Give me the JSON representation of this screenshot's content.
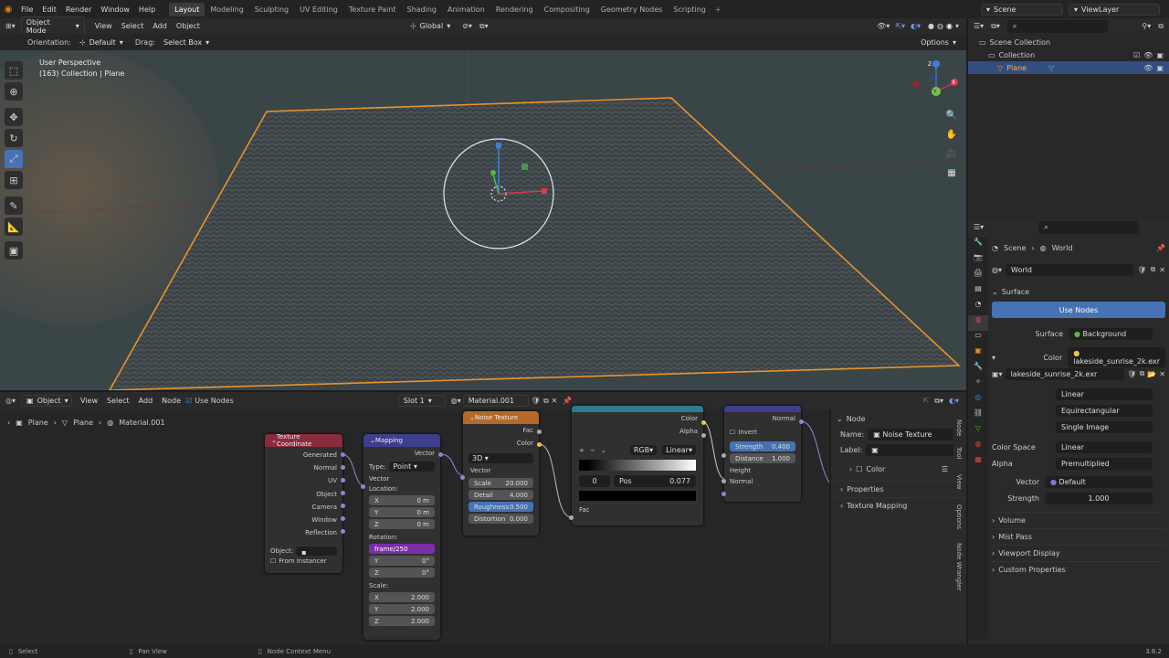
{
  "menubar": {
    "items": [
      "File",
      "Edit",
      "Render",
      "Window",
      "Help"
    ],
    "workspaces": [
      "Layout",
      "Modeling",
      "Sculpting",
      "UV Editing",
      "Texture Paint",
      "Shading",
      "Animation",
      "Rendering",
      "Compositing",
      "Geometry Nodes",
      "Scripting"
    ],
    "active_workspace": "Layout",
    "scene": "Scene",
    "view_layer": "ViewLayer"
  },
  "viewport_header": {
    "mode": "Object Mode",
    "menus": [
      "View",
      "Select",
      "Add",
      "Object"
    ],
    "transform": "Global",
    "options": "Options"
  },
  "tool_settings": {
    "orientation_label": "Orientation:",
    "orientation": "Default",
    "drag_label": "Drag:",
    "drag": "Select Box"
  },
  "viewport": {
    "perspective": "User Perspective",
    "collection_info": "(163) Collection | Plane",
    "gizmo_x": "X",
    "gizmo_y": "Y",
    "gizmo_z": "Z"
  },
  "outliner": {
    "root": "Scene Collection",
    "collection": "Collection",
    "object": "Plane"
  },
  "properties": {
    "breadcrumb_scene": "Scene",
    "breadcrumb_world": "World",
    "world_name": "World",
    "surface_section": "Surface",
    "use_nodes": "Use Nodes",
    "surface_label": "Surface",
    "surface_value": "Background",
    "color_label": "Color",
    "color_value": "lakeside_sunrise_2k.exr",
    "image_name": "lakeside_sunrise_2k.exr",
    "interpolation": "Linear",
    "projection": "Equirectangular",
    "source": "Single Image",
    "color_space_label": "Color Space",
    "color_space": "Linear",
    "alpha_label": "Alpha",
    "alpha": "Premultiplied",
    "vector_label": "Vector",
    "vector": "Default",
    "strength_label": "Strength",
    "strength": "1.000",
    "sections": [
      "Volume",
      "Mist Pass",
      "Viewport Display",
      "Custom Properties"
    ]
  },
  "node_editor": {
    "object_menu": "Object",
    "menus": [
      "View",
      "Select",
      "Add",
      "Node"
    ],
    "use_nodes": "Use Nodes",
    "slot": "Slot 1",
    "material": "Material.001",
    "breadcrumb": [
      "Plane",
      "Plane",
      "Material.001"
    ]
  },
  "nodes": {
    "texcoord": {
      "title": "Texture Coordinate",
      "outputs": [
        "Generated",
        "Normal",
        "UV",
        "Object",
        "Camera",
        "Window",
        "Reflection"
      ],
      "object_label": "Object:",
      "from_instancer": "From Instancer"
    },
    "mapping": {
      "title": "Mapping",
      "output": "Vector",
      "type_label": "Type:",
      "type": "Point",
      "vector": "Vector",
      "location": "Location:",
      "loc": [
        {
          "axis": "X",
          "v": "0 m"
        },
        {
          "axis": "Y",
          "v": "0 m"
        },
        {
          "axis": "Z",
          "v": "0 m"
        }
      ],
      "rotation": "Rotation:",
      "rot_x": "frame/250",
      "rot": [
        {
          "axis": "Y",
          "v": "0°"
        },
        {
          "axis": "Z",
          "v": "0°"
        }
      ],
      "scale": "Scale:",
      "scl": [
        {
          "axis": "X",
          "v": "2.000"
        },
        {
          "axis": "Y",
          "v": "2.000"
        },
        {
          "axis": "Z",
          "v": "2.000"
        }
      ]
    },
    "noise": {
      "title": "Noise Texture",
      "out_fac": "Fac",
      "out_color": "Color",
      "dim": "3D",
      "vector": "Vector",
      "fields": [
        {
          "k": "Scale",
          "v": "20.000"
        },
        {
          "k": "Detail",
          "v": "4.000"
        },
        {
          "k": "Roughness",
          "v": "0.500"
        },
        {
          "k": "Distortion",
          "v": "0.000"
        }
      ]
    },
    "ramp": {
      "title": "Color Ramp",
      "out_color": "Color",
      "out_alpha": "Alpha",
      "mode": "RGB",
      "interp": "Linear",
      "index": "0",
      "pos_label": "Pos",
      "pos": "0.077",
      "in_fac": "Fac"
    },
    "bump": {
      "title": "Bump",
      "out": "Normal",
      "invert": "Invert",
      "strength_k": "Strength",
      "strength_v": "0.400",
      "distance_k": "Distance",
      "distance_v": "1.000",
      "height": "Height",
      "normal": "Normal"
    }
  },
  "node_sidebar": {
    "section": "Node",
    "name_label": "Name:",
    "name": "Noise Texture",
    "label_label": "Label:",
    "color": "Color",
    "properties": "Properties",
    "texture_mapping": "Texture Mapping",
    "tabs": [
      "Node",
      "Tool",
      "View",
      "Options",
      "Node Wrangler"
    ]
  },
  "statusbar": {
    "select": "Select",
    "pan": "Pan View",
    "context": "Node Context Menu",
    "version": "3.6.2"
  }
}
